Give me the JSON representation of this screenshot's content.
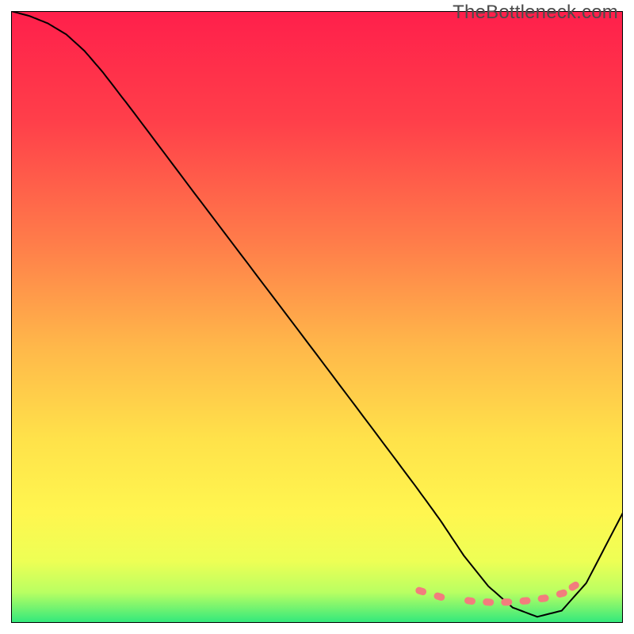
{
  "watermark": "TheBottleneck.com",
  "chart_data": {
    "type": "line",
    "title": "",
    "xlabel": "",
    "ylabel": "",
    "xlim": [
      0,
      100
    ],
    "ylim": [
      0,
      100
    ],
    "grid": false,
    "background_gradient_stops": [
      {
        "offset": 0,
        "color": "#ff1f4b"
      },
      {
        "offset": 18,
        "color": "#ff3f4a"
      },
      {
        "offset": 38,
        "color": "#ff7d4a"
      },
      {
        "offset": 55,
        "color": "#ffb84a"
      },
      {
        "offset": 70,
        "color": "#ffe24a"
      },
      {
        "offset": 82,
        "color": "#fff64f"
      },
      {
        "offset": 90,
        "color": "#edff55"
      },
      {
        "offset": 95,
        "color": "#b9ff62"
      },
      {
        "offset": 100,
        "color": "#30e87d"
      }
    ],
    "series": [
      {
        "name": "curve",
        "stroke": "#000000",
        "stroke_width": 2,
        "x": [
          0,
          3,
          6,
          9,
          12,
          15,
          20,
          30,
          40,
          50,
          60,
          66,
          70,
          74,
          78,
          82,
          86,
          90,
          94,
          100
        ],
        "y": [
          100,
          99.2,
          98,
          96.2,
          93.5,
          90,
          83.5,
          70.2,
          57,
          43.8,
          30.5,
          22.5,
          17,
          11,
          6,
          2.5,
          1,
          2,
          6.5,
          18
        ]
      },
      {
        "name": "highlight-dots",
        "type": "scatter",
        "marker": "pill",
        "color": "#f27d7d",
        "x": [
          67,
          70,
          75,
          78,
          81,
          84,
          87,
          90,
          92
        ],
        "y": [
          5.2,
          4.3,
          3.6,
          3.4,
          3.4,
          3.6,
          4.0,
          4.8,
          6.0
        ]
      }
    ]
  }
}
